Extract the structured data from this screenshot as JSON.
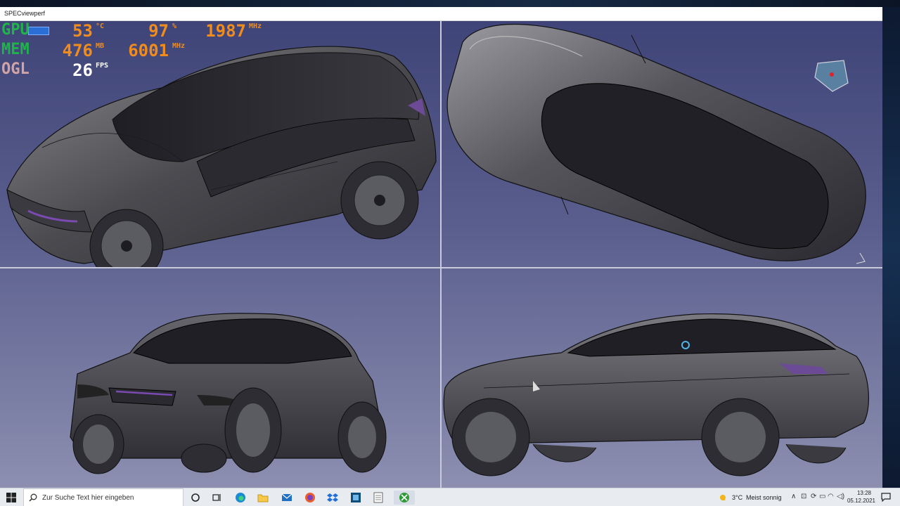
{
  "window": {
    "title": "SPECviewperf"
  },
  "overlay": {
    "rows": [
      {
        "label": "GPU",
        "label_color": "#1fb34a",
        "value1": "53",
        "unit1": "°C",
        "value2": "97",
        "unit2": "%",
        "value3": "1987",
        "unit3": "MHz"
      },
      {
        "label": "MEM",
        "label_color": "#1fb34a",
        "value1": "476",
        "unit1": "MB",
        "value2": "6001",
        "unit2": "MHz"
      },
      {
        "label": "OGL",
        "label_color": "#d0a4a4",
        "value1": "26",
        "unit1": "FPS"
      }
    ],
    "value_color": "#f08c1e",
    "fps_color": "#ffffff"
  },
  "taskbar": {
    "search_placeholder": "Zur Suche Text hier eingeben",
    "icons": [
      "cortana-icon",
      "task-view-icon",
      "edge-icon",
      "folder-icon",
      "mail-icon",
      "firefox-icon",
      "dropbox-icon",
      "app-icon",
      "notepad-icon",
      "xbox-icon"
    ],
    "weather_temp": "3°C",
    "weather_desc": "Meist sonnig",
    "time": "13:28",
    "date": "05.12.2021"
  },
  "colors": {
    "accent": "#2b6fd6",
    "viewport_top": "#3f4478",
    "viewport_bottom": "#8c8fb0"
  }
}
